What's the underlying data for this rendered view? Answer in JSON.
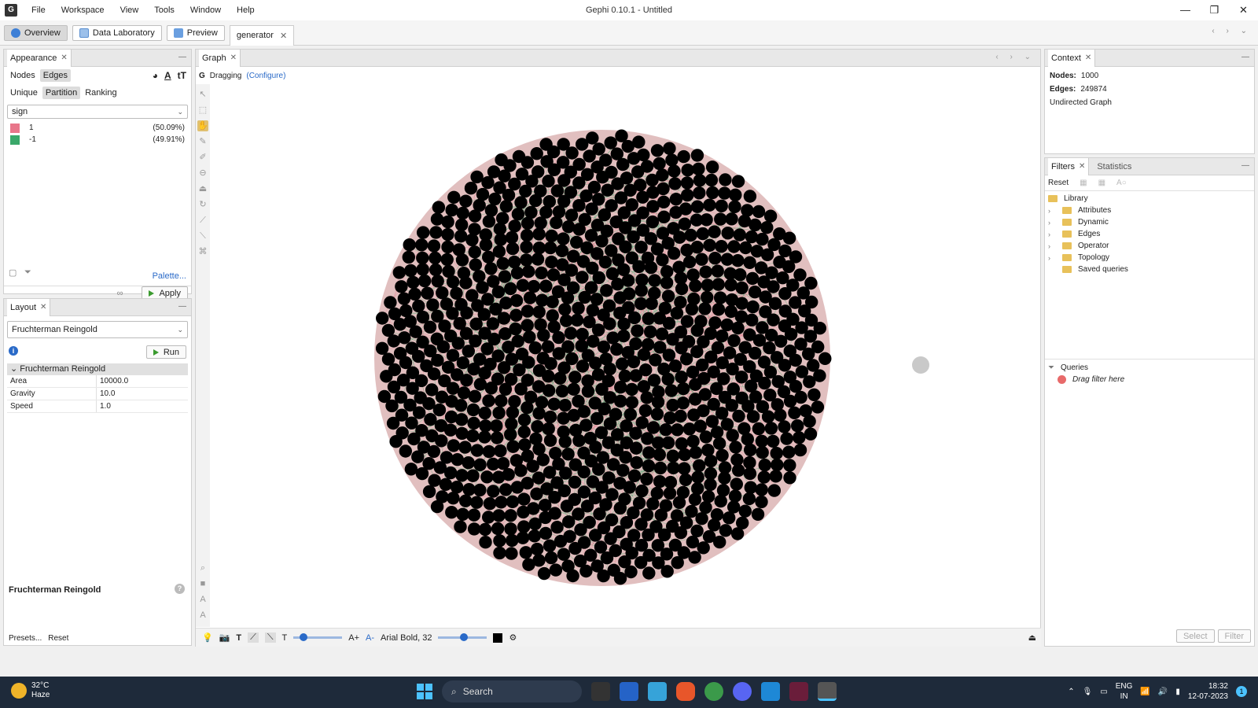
{
  "window": {
    "title": "Gephi 0.10.1 - Untitled",
    "menu": [
      "File",
      "Workspace",
      "View",
      "Tools",
      "Window",
      "Help"
    ]
  },
  "workspace_tabs": {
    "overview": "Overview",
    "data_lab": "Data Laboratory",
    "preview": "Preview",
    "doc_tab": "generator"
  },
  "appearance": {
    "tab": "Appearance",
    "nodes": "Nodes",
    "edges": "Edges",
    "unique": "Unique",
    "partition": "Partition",
    "ranking": "Ranking",
    "attribute": "sign",
    "partitions": [
      {
        "label": "1",
        "pct": "(50.09%)",
        "color": "#e8768a"
      },
      {
        "label": "-1",
        "pct": "(49.91%)",
        "color": "#3aa86a"
      }
    ],
    "palette": "Palette...",
    "apply": "Apply"
  },
  "layout": {
    "tab": "Layout",
    "algorithm": "Fruchterman Reingold",
    "run": "Run",
    "section": "Fruchterman Reingold",
    "props": [
      {
        "key": "Area",
        "value": "10000.0"
      },
      {
        "key": "Gravity",
        "value": "10.0"
      },
      {
        "key": "Speed",
        "value": "1.0"
      }
    ],
    "desc_title": "Fruchterman Reingold",
    "presets": "Presets...",
    "reset": "Reset"
  },
  "graph": {
    "tab": "Graph",
    "mode": "Dragging",
    "configure": "(Configure)",
    "font_label": "Arial Bold, 32",
    "node_color": "#000000",
    "node_count": 1000,
    "edge_colors": [
      "#e8768a",
      "#3aa86a"
    ]
  },
  "context": {
    "tab": "Context",
    "nodes_label": "Nodes:",
    "nodes_value": "1000",
    "edges_label": "Edges:",
    "edges_value": "249874",
    "graph_type": "Undirected Graph"
  },
  "filters": {
    "tab": "Filters",
    "stats_tab": "Statistics",
    "reset": "Reset",
    "library": "Library",
    "tree": [
      "Attributes",
      "Dynamic",
      "Edges",
      "Operator",
      "Topology",
      "Saved queries"
    ],
    "queries": "Queries",
    "drop_hint": "Drag filter here",
    "select_btn": "Select",
    "filter_btn": "Filter"
  },
  "taskbar": {
    "temp": "32°C",
    "weather": "Haze",
    "search": "Search",
    "lang1": "ENG",
    "lang2": "IN",
    "time": "18:32",
    "date": "12-07-2023",
    "notif": "1"
  }
}
